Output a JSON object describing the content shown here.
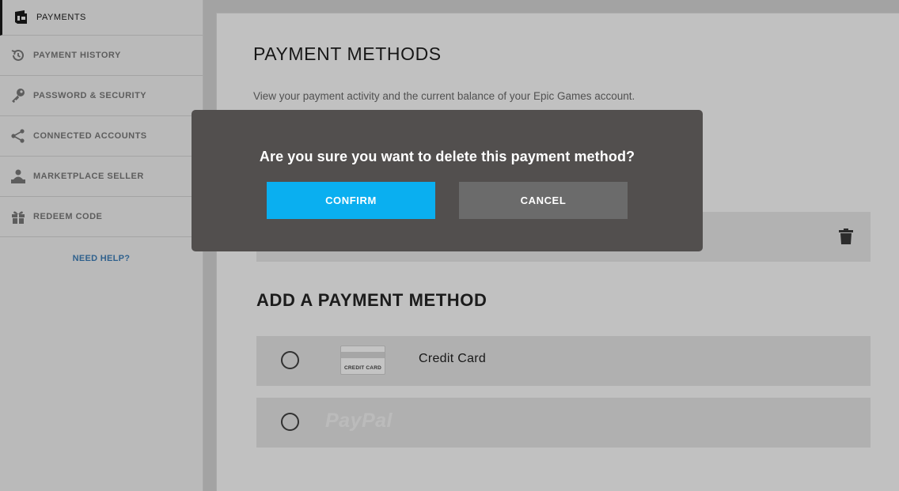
{
  "sidebar": {
    "items": [
      {
        "label": "PAYMENTS",
        "icon": "wallet-icon",
        "active": true
      },
      {
        "label": "PAYMENT HISTORY",
        "icon": "history-icon"
      },
      {
        "label": "PASSWORD & SECURITY",
        "icon": "key-icon"
      },
      {
        "label": "CONNECTED ACCOUNTS",
        "icon": "share-icon"
      },
      {
        "label": "MARKETPLACE SELLER",
        "icon": "seller-icon"
      },
      {
        "label": "REDEEM CODE",
        "icon": "gift-icon"
      }
    ],
    "help_link": "NEED HELP?"
  },
  "main": {
    "title": "PAYMENT METHODS",
    "subtitle": "View your payment activity and the current balance of your Epic Games account.",
    "saved_method": {
      "delete_icon": "trash-icon"
    },
    "add_title": "ADD A PAYMENT METHOD",
    "methods": [
      {
        "label": "Credit Card",
        "icon_text": "CREDIT CARD",
        "icon": "credit-card-icon"
      },
      {
        "label": "PayPal",
        "icon": "paypal-logo"
      }
    ]
  },
  "modal": {
    "question": "Are you sure you want to delete this payment method?",
    "confirm_label": "CONFIRM",
    "cancel_label": "CANCEL"
  },
  "colors": {
    "confirm": "#0aaff0",
    "cancel": "#6b6b6b",
    "modal_bg": "#524f4e",
    "help_link": "#3f7fb8"
  }
}
